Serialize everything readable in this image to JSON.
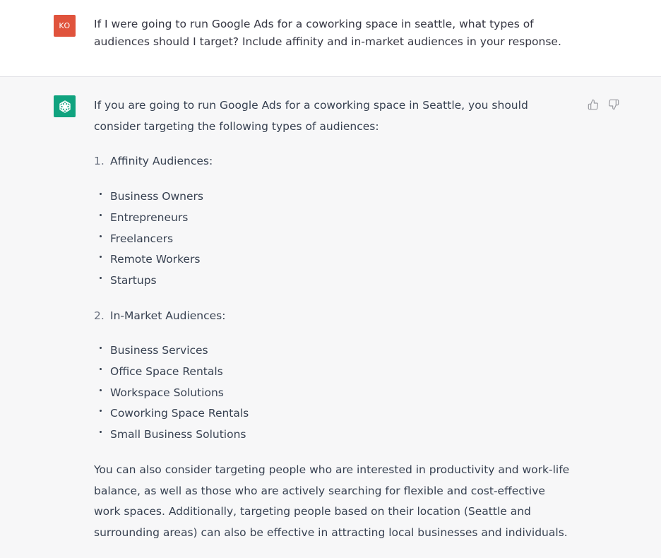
{
  "user_message": {
    "avatar_initials": "KO",
    "avatar_color": "#e0533c",
    "text": "If I were going to run Google Ads for a coworking space in seattle, what types of audiences should I target? Include affinity and in-market audiences in your response."
  },
  "assistant_message": {
    "avatar_icon": "openai-logo-icon",
    "avatar_color": "#10a37f",
    "intro": "If you are going to run Google Ads for a coworking space in Seattle, you should consider targeting the following types of audiences:",
    "sections": [
      {
        "number": "1.",
        "title": "Affinity Audiences:",
        "items": [
          "Business Owners",
          "Entrepreneurs",
          "Freelancers",
          "Remote Workers",
          "Startups"
        ]
      },
      {
        "number": "2.",
        "title": "In-Market Audiences:",
        "items": [
          "Business Services",
          "Office Space Rentals",
          "Workspace Solutions",
          "Coworking Space Rentals",
          "Small Business Solutions"
        ]
      }
    ],
    "closing": "You can also consider targeting people who are interested in productivity and work-life balance, as well as those who are actively searching for flexible and cost-effective work spaces. Additionally, targeting people based on their location (Seattle and surrounding areas) can also be effective in attracting local businesses and individuals.",
    "feedback": {
      "thumbs_up_icon": "thumbs-up-icon",
      "thumbs_down_icon": "thumbs-down-icon"
    }
  }
}
